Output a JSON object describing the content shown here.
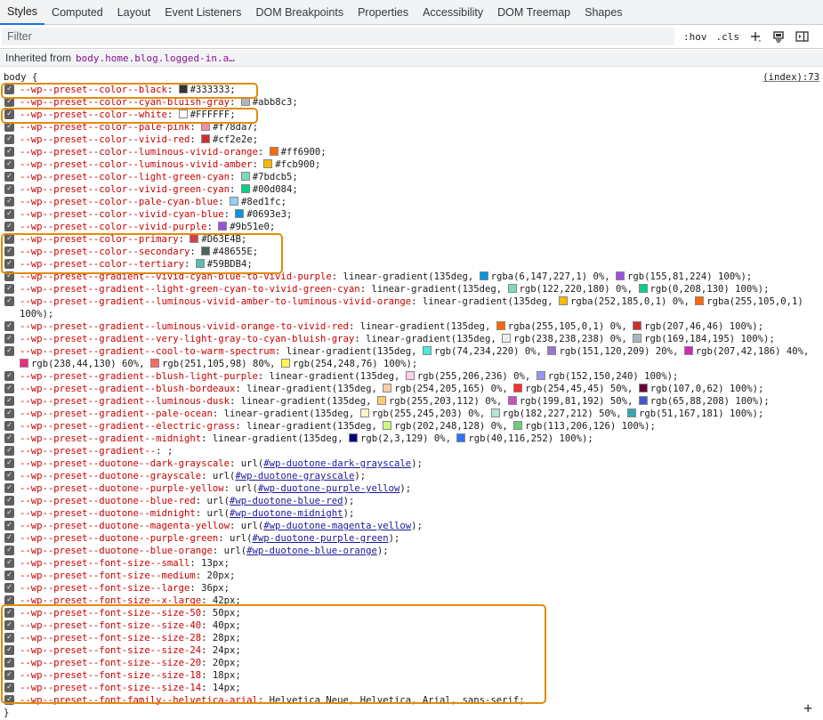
{
  "tabs": [
    "Styles",
    "Computed",
    "Layout",
    "Event Listeners",
    "DOM Breakpoints",
    "Properties",
    "Accessibility",
    "DOM Treemap",
    "Shapes"
  ],
  "active_tab": "Styles",
  "filter": {
    "placeholder": "Filter",
    "hov": ":hov",
    "cls": ".cls"
  },
  "inherited": {
    "label": "Inherited from",
    "selector": "body.home.blog.logged-in.a…"
  },
  "rule": {
    "selector": "body {",
    "source": "(index):73",
    "close": "}"
  },
  "colors": {
    "highlight": "#e38b0b",
    "property": "#c80000"
  },
  "declarations": [
    {
      "prop": "--wp--preset--color--black",
      "parts": [
        {
          "t": "sw",
          "c": "#333333"
        },
        {
          "t": "x",
          "v": "#333333"
        }
      ]
    },
    {
      "prop": "--wp--preset--color--cyan-bluish-gray",
      "parts": [
        {
          "t": "sw",
          "c": "#abb8c3"
        },
        {
          "t": "x",
          "v": "#abb8c3"
        }
      ]
    },
    {
      "prop": "--wp--preset--color--white",
      "parts": [
        {
          "t": "sw",
          "c": "#FFFFFF"
        },
        {
          "t": "x",
          "v": "#FFFFFF"
        }
      ]
    },
    {
      "prop": "--wp--preset--color--pale-pink",
      "parts": [
        {
          "t": "sw",
          "c": "#f78da7"
        },
        {
          "t": "x",
          "v": "#f78da7"
        }
      ]
    },
    {
      "prop": "--wp--preset--color--vivid-red",
      "parts": [
        {
          "t": "sw",
          "c": "#cf2e2e"
        },
        {
          "t": "x",
          "v": "#cf2e2e"
        }
      ]
    },
    {
      "prop": "--wp--preset--color--luminous-vivid-orange",
      "parts": [
        {
          "t": "sw",
          "c": "#ff6900"
        },
        {
          "t": "x",
          "v": "#ff6900"
        }
      ]
    },
    {
      "prop": "--wp--preset--color--luminous-vivid-amber",
      "parts": [
        {
          "t": "sw",
          "c": "#fcb900"
        },
        {
          "t": "x",
          "v": "#fcb900"
        }
      ]
    },
    {
      "prop": "--wp--preset--color--light-green-cyan",
      "parts": [
        {
          "t": "sw",
          "c": "#7bdcb5"
        },
        {
          "t": "x",
          "v": "#7bdcb5"
        }
      ]
    },
    {
      "prop": "--wp--preset--color--vivid-green-cyan",
      "parts": [
        {
          "t": "sw",
          "c": "#00d084"
        },
        {
          "t": "x",
          "v": "#00d084"
        }
      ]
    },
    {
      "prop": "--wp--preset--color--pale-cyan-blue",
      "parts": [
        {
          "t": "sw",
          "c": "#8ed1fc"
        },
        {
          "t": "x",
          "v": "#8ed1fc"
        }
      ]
    },
    {
      "prop": "--wp--preset--color--vivid-cyan-blue",
      "parts": [
        {
          "t": "sw",
          "c": "#0693e3"
        },
        {
          "t": "x",
          "v": "#0693e3"
        }
      ]
    },
    {
      "prop": "--wp--preset--color--vivid-purple",
      "parts": [
        {
          "t": "sw",
          "c": "#9b51e0"
        },
        {
          "t": "x",
          "v": "#9b51e0"
        }
      ]
    },
    {
      "prop": "--wp--preset--color--primary",
      "parts": [
        {
          "t": "sw",
          "c": "#D63E4B"
        },
        {
          "t": "x",
          "v": "#D63E4B"
        }
      ]
    },
    {
      "prop": "--wp--preset--color--secondary",
      "parts": [
        {
          "t": "sw",
          "c": "#48655E"
        },
        {
          "t": "x",
          "v": "#48655E"
        }
      ]
    },
    {
      "prop": "--wp--preset--color--tertiary",
      "parts": [
        {
          "t": "sw",
          "c": "#59BDB4"
        },
        {
          "t": "x",
          "v": "#59BDB4"
        }
      ]
    },
    {
      "prop": "--wp--preset--gradient--vivid-cyan-blue-to-vivid-purple",
      "parts": [
        {
          "t": "x",
          "v": "linear-gradient(135deg,"
        },
        {
          "t": "sw",
          "c": "#0693e3"
        },
        {
          "t": "x",
          "v": "rgba(6,147,227,1) 0%,"
        },
        {
          "t": "sw",
          "c": "#9b51e0"
        },
        {
          "t": "x",
          "v": "rgb(155,81,224) 100%)"
        }
      ]
    },
    {
      "prop": "--wp--preset--gradient--light-green-cyan-to-vivid-green-cyan",
      "parts": [
        {
          "t": "x",
          "v": "linear-gradient(135deg,"
        },
        {
          "t": "sw",
          "c": "#7adcb4"
        },
        {
          "t": "x",
          "v": "rgb(122,220,180) 0%,"
        },
        {
          "t": "sw",
          "c": "#00d082"
        },
        {
          "t": "x",
          "v": "rgb(0,208,130) 100%)"
        }
      ]
    },
    {
      "prop": "--wp--preset--gradient--luminous-vivid-amber-to-luminous-vivid-orange",
      "wrap": true,
      "parts": [
        {
          "t": "x",
          "v": "linear-gradient(135deg,"
        },
        {
          "t": "sw",
          "c": "#fcb900"
        },
        {
          "t": "x",
          "v": "rgba(252,185,0,1) 0%,"
        },
        {
          "t": "sw",
          "c": "#ff6900"
        },
        {
          "t": "x",
          "v": "rgba(255,105,0,1) 100%)"
        }
      ]
    },
    {
      "prop": "--wp--preset--gradient--luminous-vivid-orange-to-vivid-red",
      "parts": [
        {
          "t": "x",
          "v": "linear-gradient(135deg,"
        },
        {
          "t": "sw",
          "c": "#ff6900"
        },
        {
          "t": "x",
          "v": "rgba(255,105,0,1) 0%,"
        },
        {
          "t": "sw",
          "c": "#cf2e2e"
        },
        {
          "t": "x",
          "v": "rgb(207,46,46) 100%)"
        }
      ]
    },
    {
      "prop": "--wp--preset--gradient--very-light-gray-to-cyan-bluish-gray",
      "parts": [
        {
          "t": "x",
          "v": "linear-gradient(135deg,"
        },
        {
          "t": "sw",
          "c": "#eeeeee"
        },
        {
          "t": "x",
          "v": "rgb(238,238,238) 0%,"
        },
        {
          "t": "sw",
          "c": "#a9b8c3"
        },
        {
          "t": "x",
          "v": "rgb(169,184,195) 100%)"
        }
      ]
    },
    {
      "prop": "--wp--preset--gradient--cool-to-warm-spectrum",
      "wrap": true,
      "parts": [
        {
          "t": "x",
          "v": "linear-gradient(135deg,"
        },
        {
          "t": "sw",
          "c": "#4aeadc"
        },
        {
          "t": "x",
          "v": "rgb(74,234,220) 0%,"
        },
        {
          "t": "sw",
          "c": "#9778d1"
        },
        {
          "t": "x",
          "v": "rgb(151,120,209) 20%,"
        },
        {
          "t": "sw",
          "c": "#cf2aba"
        },
        {
          "t": "x",
          "v": "rgb(207,42,186) 40%,"
        },
        {
          "t": "sw",
          "c": "#ee2c82"
        },
        {
          "t": "x",
          "v": "rgb(238,44,130) 60%,"
        },
        {
          "t": "sw",
          "c": "#fb6962"
        },
        {
          "t": "x",
          "v": "rgb(251,105,98) 80%,"
        },
        {
          "t": "sw",
          "c": "#fef84c"
        },
        {
          "t": "x",
          "v": "rgb(254,248,76) 100%)"
        }
      ]
    },
    {
      "prop": "--wp--preset--gradient--blush-light-purple",
      "parts": [
        {
          "t": "x",
          "v": "linear-gradient(135deg,"
        },
        {
          "t": "sw",
          "c": "#ffceec"
        },
        {
          "t": "x",
          "v": "rgb(255,206,236) 0%,"
        },
        {
          "t": "sw",
          "c": "#9896f0"
        },
        {
          "t": "x",
          "v": "rgb(152,150,240) 100%)"
        }
      ]
    },
    {
      "prop": "--wp--preset--gradient--blush-bordeaux",
      "parts": [
        {
          "t": "x",
          "v": "linear-gradient(135deg,"
        },
        {
          "t": "sw",
          "c": "#fecda5"
        },
        {
          "t": "x",
          "v": "rgb(254,205,165) 0%,"
        },
        {
          "t": "sw",
          "c": "#fe2d2d"
        },
        {
          "t": "x",
          "v": "rgb(254,45,45) 50%,"
        },
        {
          "t": "sw",
          "c": "#6b003e"
        },
        {
          "t": "x",
          "v": "rgb(107,0,62) 100%)"
        }
      ]
    },
    {
      "prop": "--wp--preset--gradient--luminous-dusk",
      "parts": [
        {
          "t": "x",
          "v": "linear-gradient(135deg,"
        },
        {
          "t": "sw",
          "c": "#ffcb70"
        },
        {
          "t": "x",
          "v": "rgb(255,203,112) 0%,"
        },
        {
          "t": "sw",
          "c": "#c751c0"
        },
        {
          "t": "x",
          "v": "rgb(199,81,192) 50%,"
        },
        {
          "t": "sw",
          "c": "#4158d0"
        },
        {
          "t": "x",
          "v": "rgb(65,88,208) 100%)"
        }
      ]
    },
    {
      "prop": "--wp--preset--gradient--pale-ocean",
      "parts": [
        {
          "t": "x",
          "v": "linear-gradient(135deg,"
        },
        {
          "t": "sw",
          "c": "#fff5cb"
        },
        {
          "t": "x",
          "v": "rgb(255,245,203) 0%,"
        },
        {
          "t": "sw",
          "c": "#b6e3d4"
        },
        {
          "t": "x",
          "v": "rgb(182,227,212) 50%,"
        },
        {
          "t": "sw",
          "c": "#33a7b5"
        },
        {
          "t": "x",
          "v": "rgb(51,167,181) 100%)"
        }
      ]
    },
    {
      "prop": "--wp--preset--gradient--electric-grass",
      "parts": [
        {
          "t": "x",
          "v": "linear-gradient(135deg,"
        },
        {
          "t": "sw",
          "c": "#caf880"
        },
        {
          "t": "x",
          "v": "rgb(202,248,128) 0%,"
        },
        {
          "t": "sw",
          "c": "#71ce7e"
        },
        {
          "t": "x",
          "v": "rgb(113,206,126) 100%)"
        }
      ]
    },
    {
      "prop": "--wp--preset--gradient--midnight",
      "parts": [
        {
          "t": "x",
          "v": "linear-gradient(135deg,"
        },
        {
          "t": "sw",
          "c": "#020381"
        },
        {
          "t": "x",
          "v": "rgb(2,3,129) 0%,"
        },
        {
          "t": "sw",
          "c": "#2874fc"
        },
        {
          "t": "x",
          "v": "rgb(40,116,252) 100%)"
        }
      ]
    },
    {
      "prop": "--wp--preset--gradient--",
      "parts": [
        {
          "t": "x",
          "v": ""
        }
      ]
    },
    {
      "prop": "--wp--preset--duotone--dark-grayscale",
      "parts": [
        {
          "t": "x",
          "v": "url("
        },
        {
          "t": "l",
          "v": "#wp-duotone-dark-grayscale"
        },
        {
          "t": "x",
          "v": ")"
        }
      ]
    },
    {
      "prop": "--wp--preset--duotone--grayscale",
      "parts": [
        {
          "t": "x",
          "v": "url("
        },
        {
          "t": "l",
          "v": "#wp-duotone-grayscale"
        },
        {
          "t": "x",
          "v": ")"
        }
      ]
    },
    {
      "prop": "--wp--preset--duotone--purple-yellow",
      "parts": [
        {
          "t": "x",
          "v": "url("
        },
        {
          "t": "l",
          "v": "#wp-duotone-purple-yellow"
        },
        {
          "t": "x",
          "v": ")"
        }
      ]
    },
    {
      "prop": "--wp--preset--duotone--blue-red",
      "parts": [
        {
          "t": "x",
          "v": "url("
        },
        {
          "t": "l",
          "v": "#wp-duotone-blue-red"
        },
        {
          "t": "x",
          "v": ")"
        }
      ]
    },
    {
      "prop": "--wp--preset--duotone--midnight",
      "parts": [
        {
          "t": "x",
          "v": "url("
        },
        {
          "t": "l",
          "v": "#wp-duotone-midnight"
        },
        {
          "t": "x",
          "v": ")"
        }
      ]
    },
    {
      "prop": "--wp--preset--duotone--magenta-yellow",
      "parts": [
        {
          "t": "x",
          "v": "url("
        },
        {
          "t": "l",
          "v": "#wp-duotone-magenta-yellow"
        },
        {
          "t": "x",
          "v": ")"
        }
      ]
    },
    {
      "prop": "--wp--preset--duotone--purple-green",
      "parts": [
        {
          "t": "x",
          "v": "url("
        },
        {
          "t": "l",
          "v": "#wp-duotone-purple-green"
        },
        {
          "t": "x",
          "v": ")"
        }
      ]
    },
    {
      "prop": "--wp--preset--duotone--blue-orange",
      "parts": [
        {
          "t": "x",
          "v": "url("
        },
        {
          "t": "l",
          "v": "#wp-duotone-blue-orange"
        },
        {
          "t": "x",
          "v": ")"
        }
      ]
    },
    {
      "prop": "--wp--preset--font-size--small",
      "parts": [
        {
          "t": "x",
          "v": "13px"
        }
      ]
    },
    {
      "prop": "--wp--preset--font-size--medium",
      "parts": [
        {
          "t": "x",
          "v": "20px"
        }
      ]
    },
    {
      "prop": "--wp--preset--font-size--large",
      "parts": [
        {
          "t": "x",
          "v": "36px"
        }
      ]
    },
    {
      "prop": "--wp--preset--font-size--x-large",
      "parts": [
        {
          "t": "x",
          "v": "42px"
        }
      ]
    },
    {
      "prop": "--wp--preset--font-size--size-50",
      "parts": [
        {
          "t": "x",
          "v": "50px"
        }
      ]
    },
    {
      "prop": "--wp--preset--font-size--size-40",
      "parts": [
        {
          "t": "x",
          "v": "40px"
        }
      ]
    },
    {
      "prop": "--wp--preset--font-size--size-28",
      "parts": [
        {
          "t": "x",
          "v": "28px"
        }
      ]
    },
    {
      "prop": "--wp--preset--font-size--size-24",
      "parts": [
        {
          "t": "x",
          "v": "24px"
        }
      ]
    },
    {
      "prop": "--wp--preset--font-size--size-20",
      "parts": [
        {
          "t": "x",
          "v": "20px"
        }
      ]
    },
    {
      "prop": "--wp--preset--font-size--size-18",
      "parts": [
        {
          "t": "x",
          "v": "18px"
        }
      ]
    },
    {
      "prop": "--wp--preset--font-size--size-14",
      "parts": [
        {
          "t": "x",
          "v": "14px"
        }
      ]
    },
    {
      "prop": "--wp--preset--font-family--helvetica-arial",
      "parts": [
        {
          "t": "x",
          "v": "Helvetica Neue, Helvetica, Arial, sans-serif"
        }
      ]
    }
  ]
}
